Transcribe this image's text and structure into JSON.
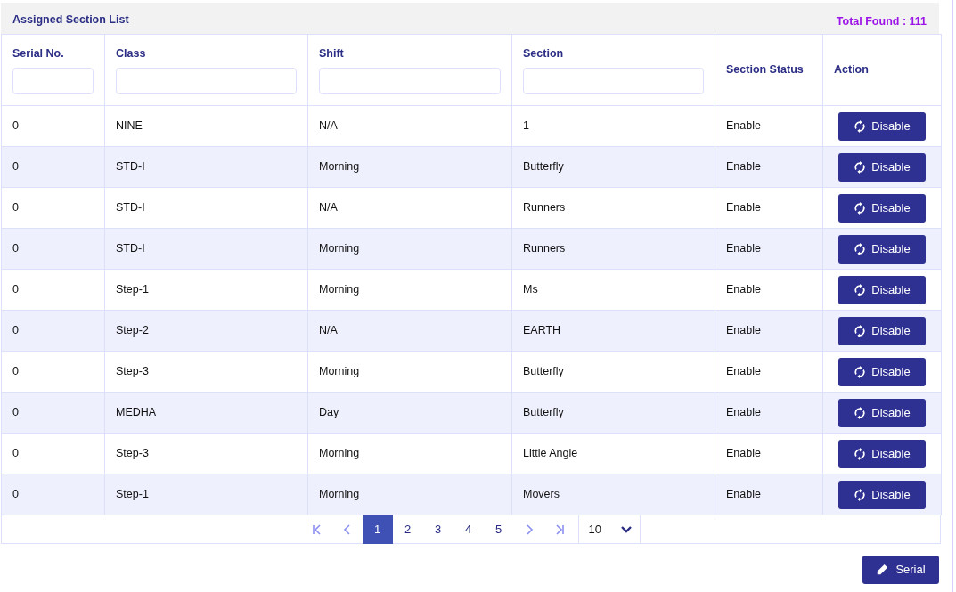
{
  "panel": {
    "title": "Assigned Section List",
    "total": "Total Found : 111"
  },
  "table": {
    "columns": [
      {
        "label": "Serial No.",
        "filter": true
      },
      {
        "label": "Class",
        "filter": true
      },
      {
        "label": "Shift",
        "filter": true
      },
      {
        "label": "Section",
        "filter": true
      },
      {
        "label": "Section Status",
        "filter": false
      },
      {
        "label": "Action",
        "filter": false
      }
    ],
    "rows": [
      {
        "serial": "0",
        "class": "NINE",
        "shift": "N/A",
        "section": "1",
        "status": "Enable",
        "action": "Disable"
      },
      {
        "serial": "0",
        "class": "STD-I",
        "shift": "Morning",
        "section": "Butterfly",
        "status": "Enable",
        "action": "Disable"
      },
      {
        "serial": "0",
        "class": "STD-I",
        "shift": "N/A",
        "section": "Runners",
        "status": "Enable",
        "action": "Disable"
      },
      {
        "serial": "0",
        "class": "STD-I",
        "shift": "Morning",
        "section": "Runners",
        "status": "Enable",
        "action": "Disable"
      },
      {
        "serial": "0",
        "class": "Step-1",
        "shift": "Morning",
        "section": "Ms",
        "status": "Enable",
        "action": "Disable"
      },
      {
        "serial": "0",
        "class": "Step-2",
        "shift": "N/A",
        "section": "EARTH",
        "status": "Enable",
        "action": "Disable"
      },
      {
        "serial": "0",
        "class": "Step-3",
        "shift": "Morning",
        "section": "Butterfly",
        "status": "Enable",
        "action": "Disable"
      },
      {
        "serial": "0",
        "class": "MEDHA",
        "shift": "Day",
        "section": "Butterfly",
        "status": "Enable",
        "action": "Disable"
      },
      {
        "serial": "0",
        "class": "Step-3",
        "shift": "Morning",
        "section": "Little Angle",
        "status": "Enable",
        "action": "Disable"
      },
      {
        "serial": "0",
        "class": "Step-1",
        "shift": "Morning",
        "section": "Movers",
        "status": "Enable",
        "action": "Disable"
      }
    ]
  },
  "pagination": {
    "pages": [
      {
        "label": "1",
        "selected": true
      },
      {
        "label": "2",
        "selected": false
      },
      {
        "label": "3",
        "selected": false
      },
      {
        "label": "4",
        "selected": false
      },
      {
        "label": "5",
        "selected": false
      }
    ],
    "page_size": "10"
  },
  "serial_button": "Serial"
}
